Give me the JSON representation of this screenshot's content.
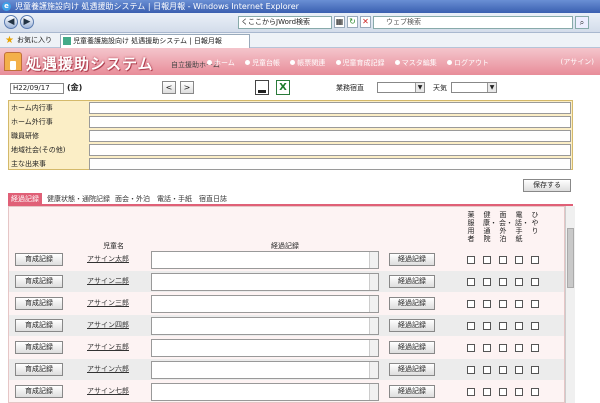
{
  "window": {
    "title": "児童養護施設向け 処遇援助システム | 日報月報 - Windows Internet Explorer"
  },
  "browser": {
    "address": "くここからJWord検索",
    "search_placeholder": "ウェブ検索",
    "favorites_label": "お気に入り",
    "tab_title": "児童養護施設向け 処遇援助システム | 日報月報"
  },
  "app": {
    "title": "処遇援助システム",
    "subtitle": "自立援助ホーム",
    "nav": [
      "ホーム",
      "児童台帳",
      "帳票関連",
      "児童育成記録",
      "マスタ編集",
      "ログアウト"
    ],
    "user": "(アサイン)"
  },
  "daily": {
    "date": "H22/09/17",
    "weekday": "(金)",
    "prev": "<",
    "next": ">",
    "duty_label": "業務宿直",
    "weather_label": "天気"
  },
  "notes": {
    "rows": [
      "ホーム内行事",
      "ホーム外行事",
      "職員研修",
      "地域社会(その他)",
      "主な出来事"
    ]
  },
  "save_button": "保存する",
  "tabs": [
    "経過記録",
    "健康状態・通院記録",
    "面会・外泊",
    "電話・手紙",
    "宿直日誌"
  ],
  "grid": {
    "col_name": "児童名",
    "col_record": "経過記録",
    "check_cols": [
      "薬服用者",
      "健康・通院",
      "面会・外泊",
      "電話・手紙",
      "ひやり"
    ],
    "row_button": "育成記録",
    "record_button": "経過記録",
    "children": [
      "アサイン太郎",
      "アサイン二郎",
      "アサイン三郎",
      "アサイン四郎",
      "アサイン五郎",
      "アサイン六郎",
      "アサイン七郎"
    ]
  }
}
